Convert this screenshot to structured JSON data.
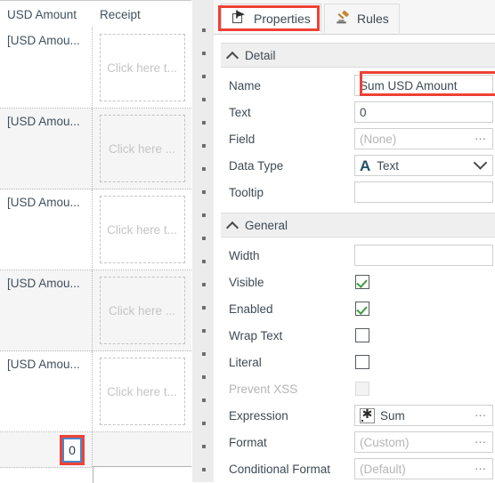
{
  "left_pane": {
    "columns": [
      {
        "key": "usd_amount",
        "label": "USD Amount"
      },
      {
        "key": "receipt",
        "label": "Receipt"
      }
    ],
    "rows": [
      {
        "amount": "[USD Amou...",
        "receipt": "Click here t...",
        "shade": "white"
      },
      {
        "amount": "[USD Amou...",
        "receipt": "Click here ...",
        "shade": "alt"
      },
      {
        "amount": "[USD Amou...",
        "receipt": "Click here t...",
        "shade": "white"
      },
      {
        "amount": "[USD Amou...",
        "receipt": "Click here ...",
        "shade": "alt"
      },
      {
        "amount": "[USD Amou...",
        "receipt": "Click here t...",
        "shade": "white"
      }
    ],
    "footer": {
      "sum_value": "0"
    }
  },
  "right_pane": {
    "tabs": [
      {
        "key": "properties",
        "label": "Properties",
        "icon": "properties-icon",
        "active": true,
        "highlighted": true
      },
      {
        "key": "rules",
        "label": "Rules",
        "icon": "gavel-icon",
        "active": false,
        "highlighted": false
      }
    ],
    "sections": [
      {
        "key": "detail",
        "title": "Detail",
        "collapse_icon": "chevron-up-icon",
        "rows": [
          {
            "key": "name",
            "label": "Name",
            "control": "text",
            "value": "Sum USD Amount",
            "highlighted": true
          },
          {
            "key": "text",
            "label": "Text",
            "control": "text",
            "value": "0"
          },
          {
            "key": "field",
            "label": "Field",
            "control": "picker",
            "value": "(None)",
            "placeholder_style": true,
            "ellipsis": "⋯"
          },
          {
            "key": "data_type",
            "label": "Data Type",
            "control": "select",
            "value": "Text",
            "icon": "letter-a-icon"
          },
          {
            "key": "tooltip",
            "label": "Tooltip",
            "control": "text",
            "value": ""
          }
        ]
      },
      {
        "key": "general",
        "title": "General",
        "collapse_icon": "chevron-up-icon",
        "rows": [
          {
            "key": "width",
            "label": "Width",
            "control": "text",
            "value": ""
          },
          {
            "key": "visible",
            "label": "Visible",
            "control": "checkbox",
            "checked": true
          },
          {
            "key": "enabled",
            "label": "Enabled",
            "control": "checkbox",
            "checked": true
          },
          {
            "key": "wrap_text",
            "label": "Wrap Text",
            "control": "checkbox",
            "checked": false
          },
          {
            "key": "literal",
            "label": "Literal",
            "control": "checkbox",
            "checked": false
          },
          {
            "key": "prevent_xss",
            "label": "Prevent XSS",
            "control": "checkbox",
            "checked": false,
            "disabled": true
          },
          {
            "key": "expression",
            "label": "Expression",
            "control": "picker",
            "value": "Sum",
            "icon": "expression-icon",
            "ellipsis": "⋯"
          },
          {
            "key": "format",
            "label": "Format",
            "control": "picker",
            "value": "(Custom)",
            "placeholder_style": true,
            "ellipsis": "⋯"
          },
          {
            "key": "conditional_format",
            "label": "Conditional Format",
            "control": "picker",
            "value": "(Default)",
            "placeholder_style": true,
            "ellipsis": "⋯"
          }
        ]
      }
    ]
  },
  "colors": {
    "highlight_red": "#ef4136",
    "selection_blue": "#4a86c8",
    "check_green": "#3d9a3d",
    "splitter_bg": "#ececec",
    "section_bg": "#efefef",
    "text": "#3f4a54",
    "muted": "#b5b5b5"
  }
}
